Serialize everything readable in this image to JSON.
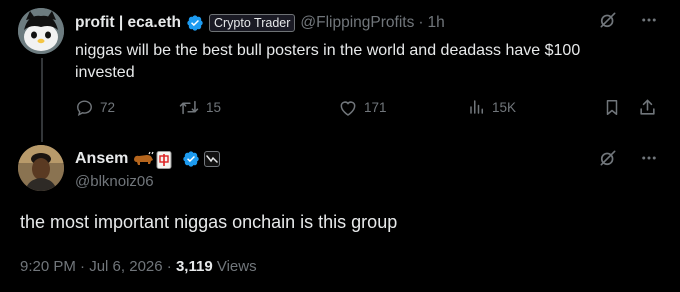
{
  "tweet1": {
    "name": "profit | eca.eth",
    "badge": "Crypto Trader",
    "handle": "@FlippingProfits",
    "time": "1h",
    "text": "niggas will be the best bull posters in the world and deadass have $100 invested",
    "metrics": {
      "replies": "72",
      "retweets": "15",
      "likes": "171",
      "views": "15K"
    }
  },
  "tweet2": {
    "name": "Ansem",
    "handle": "@blknoiz06",
    "text": "the most important niggas onchain is this group",
    "time": "9:20 PM",
    "date": "Jul 6, 2026",
    "views_count": "3,119",
    "views_label": "Views"
  },
  "colors": {
    "background": "#000000",
    "text": "#e7e9ea",
    "muted": "#71767b",
    "verified": "#1d9bf0"
  }
}
